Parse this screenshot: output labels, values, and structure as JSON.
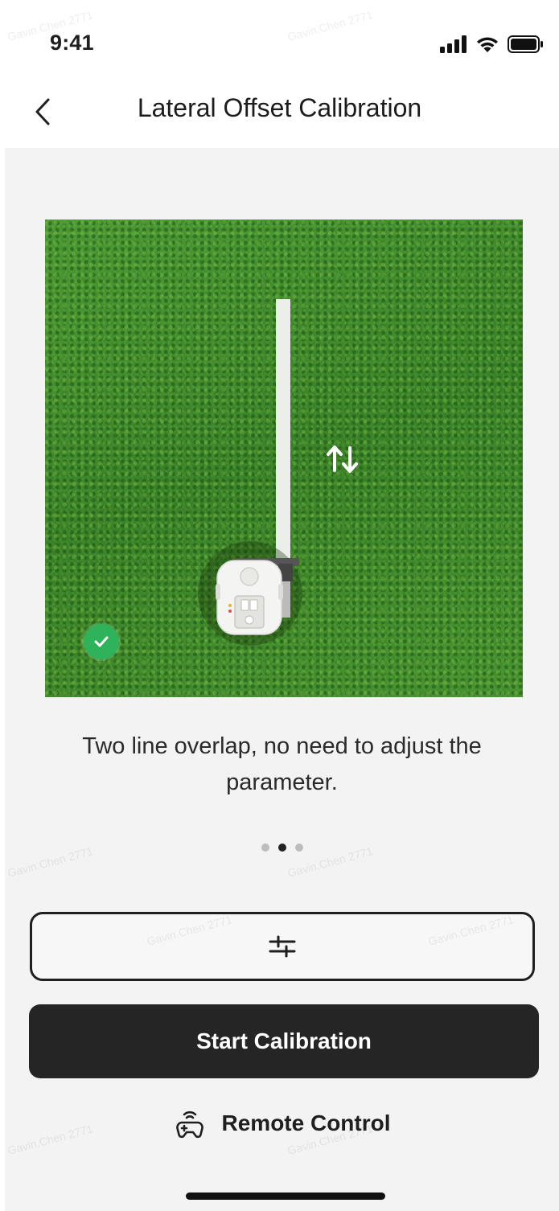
{
  "status_bar": {
    "time": "9:41"
  },
  "nav": {
    "title": "Lateral Offset Calibration",
    "back_icon": "chevron-left-icon"
  },
  "illustration": {
    "arrows_icon": "swap-vertical-icon",
    "status_icon": "check-circle-icon",
    "status_color": "#2fb35a"
  },
  "description": "Two line overlap, no need to adjust the parameter.",
  "pager": {
    "total": 3,
    "active_index": 1
  },
  "buttons": {
    "adjust_icon": "sliders-icon",
    "start_label": "Start Calibration",
    "remote_label": "Remote Control",
    "remote_icon": "remote-controller-icon"
  },
  "watermark": "Gavin.Chen 2771",
  "colors": {
    "primary_button": "#252525",
    "background": "#f3f3f3",
    "success": "#2fb35a"
  }
}
